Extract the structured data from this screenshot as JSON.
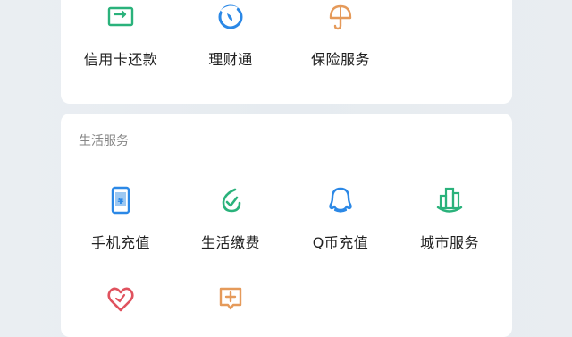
{
  "finance": {
    "items": [
      {
        "label": "信用卡还款",
        "icon": "credit-card-repay-icon",
        "color": "#2ab27b"
      },
      {
        "label": "理财通",
        "icon": "wealth-icon",
        "color": "#2b88e6"
      },
      {
        "label": "保险服务",
        "icon": "insurance-icon",
        "color": "#e59a5a"
      }
    ]
  },
  "life_services": {
    "title": "生活服务",
    "items": [
      {
        "label": "手机充值",
        "icon": "phone-topup-icon",
        "color": "#2b88e6"
      },
      {
        "label": "生活缴费",
        "icon": "utility-payment-icon",
        "color": "#2ab27b"
      },
      {
        "label": "Q币充值",
        "icon": "qq-coin-icon",
        "color": "#2b88e6"
      },
      {
        "label": "城市服务",
        "icon": "city-service-icon",
        "color": "#2ab27b"
      },
      {
        "label": "",
        "icon": "charity-heart-icon",
        "color": "#e0525e"
      },
      {
        "label": "",
        "icon": "health-plus-icon",
        "color": "#e59a5a"
      }
    ]
  }
}
